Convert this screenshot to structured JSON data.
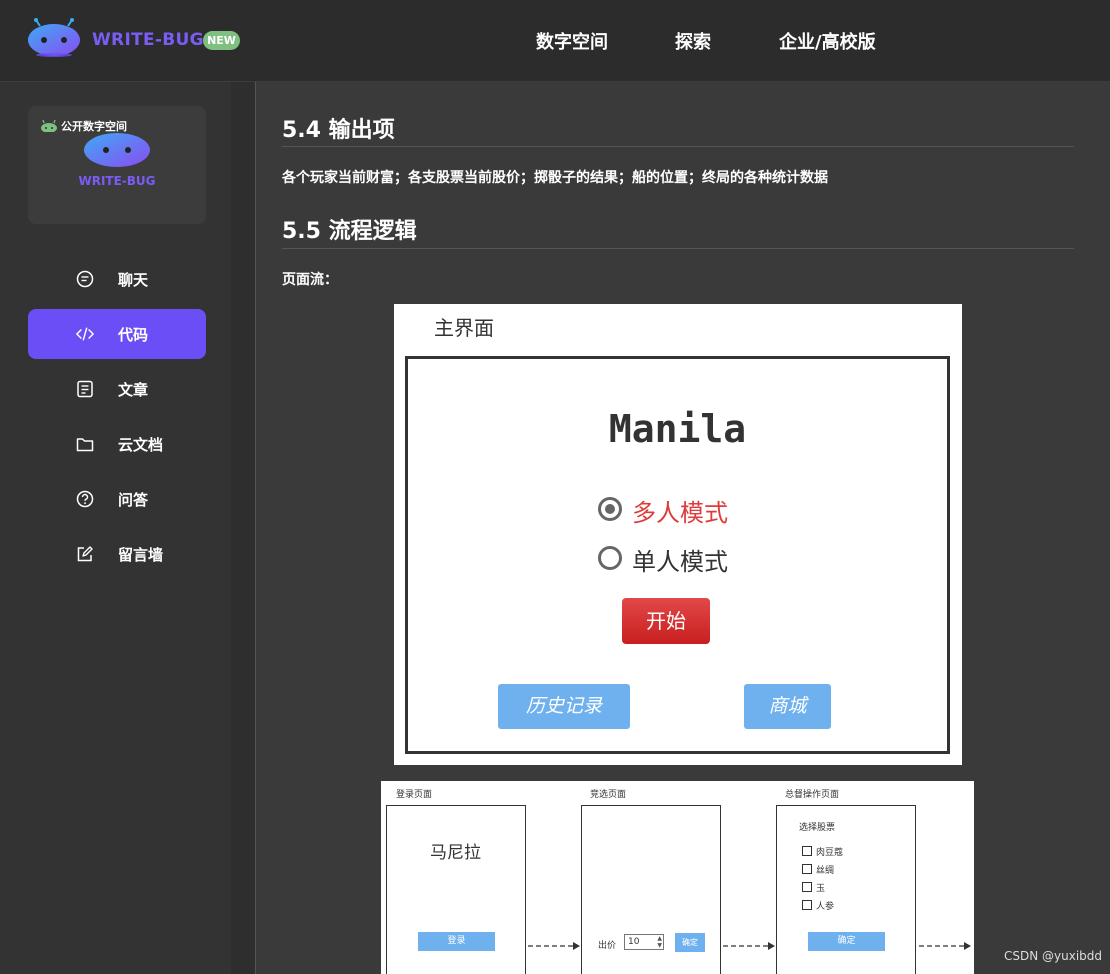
{
  "header": {
    "brand": "WRITE-BUG",
    "badge": "NEW",
    "nav": [
      "数字空间",
      "探索",
      "企业/高校版"
    ]
  },
  "sidebar": {
    "space_card": {
      "tag": "公开数字空间",
      "brand": "WRITE-BUG"
    },
    "items": [
      {
        "label": "聊天",
        "icon": "chat-icon",
        "active": false
      },
      {
        "label": "代码",
        "icon": "code-icon",
        "active": true
      },
      {
        "label": "文章",
        "icon": "article-icon",
        "active": false
      },
      {
        "label": "云文档",
        "icon": "folder-icon",
        "active": false
      },
      {
        "label": "问答",
        "icon": "question-icon",
        "active": false
      },
      {
        "label": "留言墙",
        "icon": "edit-icon",
        "active": false
      }
    ]
  },
  "content": {
    "section_54_title": "5.4 输出项",
    "section_54_text": "各个玩家当前财富；各支股票当前股价；掷骰子的结果；船的位置；终局的各种统计数据",
    "section_55_title": "5.5 流程逻辑",
    "page_flow_label": "页面流：",
    "figure_main": {
      "title": "主界面",
      "game_title": "Manila",
      "option_multi": "多人模式",
      "option_single": "单人模式",
      "start": "开始",
      "history": "历史记录",
      "shop": "商城"
    },
    "figure_flow": {
      "login_caption": "登录页面",
      "login_title": "马尼拉",
      "login_button": "登录",
      "bid_caption": "竞选页面",
      "bid_label": "出价",
      "bid_value": "10",
      "bid_confirm": "确定",
      "admin_caption": "总督操作页面",
      "admin_title": "选择股票",
      "stocks": [
        "肉豆蔻",
        "丝绸",
        "玉",
        "人参"
      ],
      "admin_confirm": "确定"
    }
  },
  "watermark": "CSDN @yuxibdd",
  "colors": {
    "accent": "#6b4ef5",
    "badge": "#7fbf7f",
    "selected_option": "#e03b3b",
    "blue_button": "#6fb1ef"
  }
}
